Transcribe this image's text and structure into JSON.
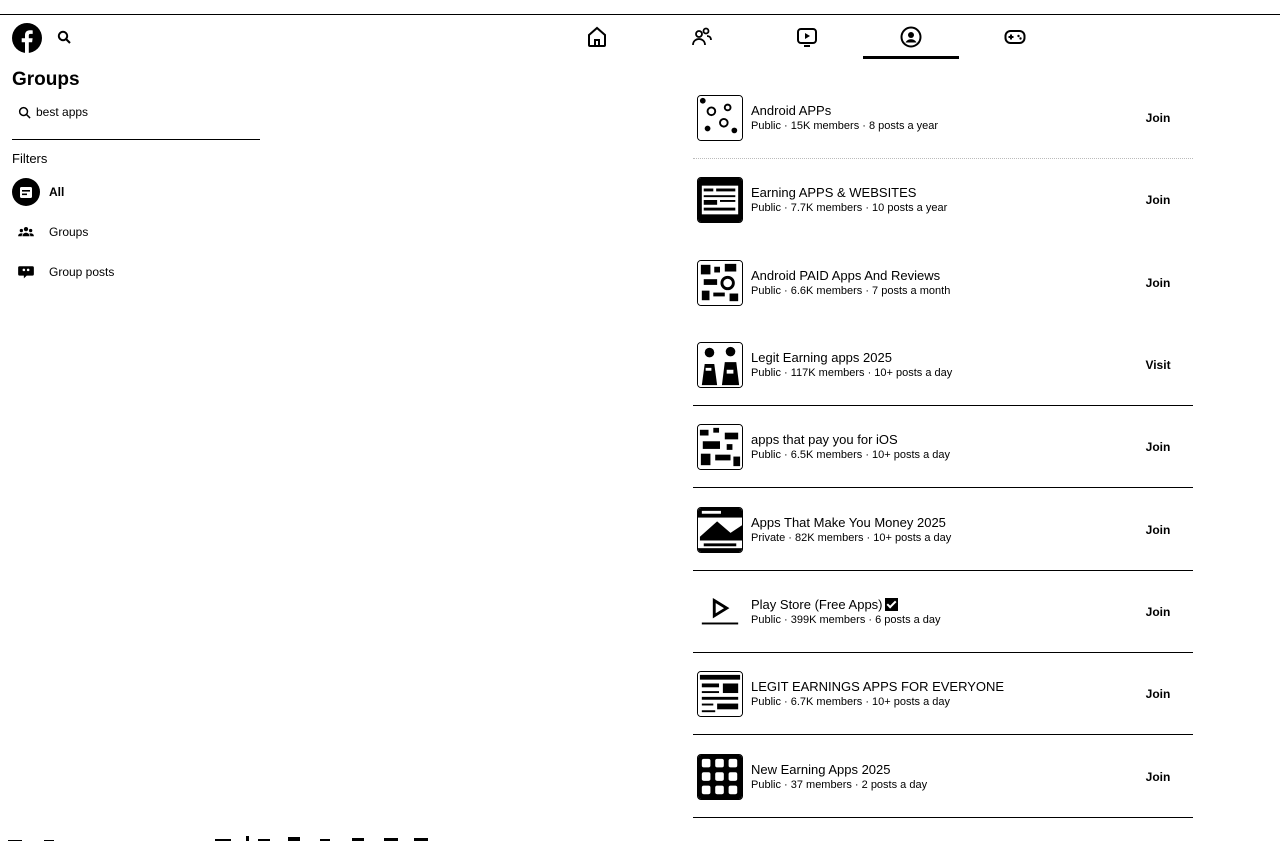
{
  "header": {
    "logo_icon": "facebook-logo-icon",
    "search_icon": "search-icon",
    "nav_tabs": [
      {
        "name": "home",
        "icon": "home-icon",
        "active": false
      },
      {
        "name": "friends",
        "icon": "friends-icon",
        "active": false
      },
      {
        "name": "video",
        "icon": "video-icon",
        "active": false
      },
      {
        "name": "groups",
        "icon": "groups-icon",
        "active": true
      },
      {
        "name": "gaming",
        "icon": "gaming-icon",
        "active": false
      }
    ]
  },
  "sidebar": {
    "title": "Groups",
    "search_value": "best apps",
    "filters_label": "Filters",
    "filters": [
      {
        "label": "All",
        "icon": "all-results-icon",
        "active": true
      },
      {
        "label": "Groups",
        "icon": "groups-icon",
        "active": false
      },
      {
        "label": "Group posts",
        "icon": "group-posts-icon",
        "active": false
      }
    ]
  },
  "results": [
    {
      "name": "Android APPs",
      "meta": "Public · 15K members · 8 posts a year",
      "action": "Join",
      "verified": false
    },
    {
      "name": "Earning APPS & WEBSITES",
      "meta": "Public · 7.7K members · 10 posts a year",
      "action": "Join",
      "verified": false
    },
    {
      "name": "Android PAID Apps And Reviews",
      "meta": "Public · 6.6K members · 7 posts a month",
      "action": "Join",
      "verified": false
    },
    {
      "name": "Legit Earning apps 2025",
      "meta": "Public · 117K members · 10+ posts a day",
      "action": "Visit",
      "verified": false
    },
    {
      "name": "apps that pay you for iOS",
      "meta": "Public · 6.5K members · 10+ posts a day",
      "action": "Join",
      "verified": false
    },
    {
      "name": "Apps That Make You Money 2025",
      "meta": "Private · 82K members · 10+ posts a day",
      "action": "Join",
      "verified": false
    },
    {
      "name": "Play Store (Free Apps)",
      "meta": "Public · 399K members · 6 posts a day",
      "action": "Join",
      "verified": true
    },
    {
      "name": "LEGIT EARNINGS APPS FOR EVERYONE",
      "meta": "Public · 6.7K members · 10+ posts a day",
      "action": "Join",
      "verified": false
    },
    {
      "name": "New Earning Apps 2025",
      "meta": "Public · 37 members · 2 posts a day",
      "action": "Join",
      "verified": false
    }
  ]
}
